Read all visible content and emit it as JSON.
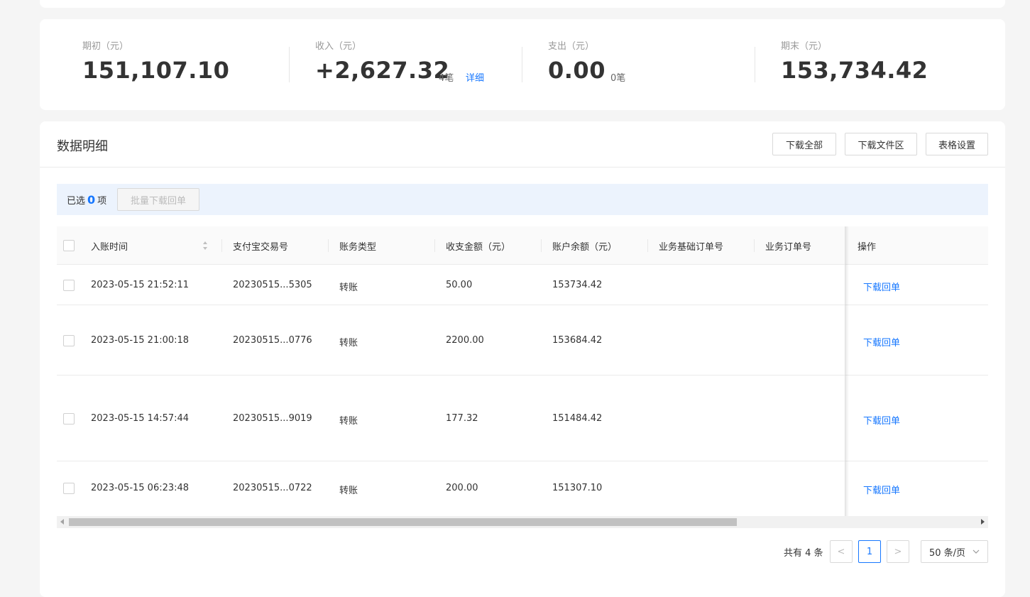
{
  "summary": {
    "opening": {
      "label": "期初（元）",
      "value": "151,107.10"
    },
    "income": {
      "label": "收入（元）",
      "value": "+2,627.32",
      "count": "4笔",
      "detail": "详细"
    },
    "expense": {
      "label": "支出（元）",
      "value": "0.00",
      "count": "0笔"
    },
    "closing": {
      "label": "期末（元）",
      "value": "153,734.42"
    }
  },
  "details": {
    "title": "数据明细",
    "buttons": {
      "download_all": "下载全部",
      "download_area": "下载文件区",
      "table_settings": "表格设置"
    },
    "selection": {
      "prefix": "已选",
      "count": "0",
      "suffix": "项",
      "batch_download": "批量下载回单"
    },
    "columns": [
      "入账时间",
      "支付宝交易号",
      "账务类型",
      "收支金额（元）",
      "账户余额（元）",
      "业务基础订单号",
      "业务订单号",
      "操作"
    ],
    "rows": [
      {
        "time": "2023-05-15 21:52:11",
        "trade_no": "20230515...5305",
        "type": "转账",
        "amount": "50.00",
        "balance": "153734.42",
        "action": "下载回单"
      },
      {
        "time": "2023-05-15 21:00:18",
        "trade_no": "20230515...0776",
        "type": "转账",
        "amount": "2200.00",
        "balance": "153684.42",
        "action": "下载回单"
      },
      {
        "time": "2023-05-15 14:57:44",
        "trade_no": "20230515...9019",
        "type": "转账",
        "amount": "177.32",
        "balance": "151484.42",
        "action": "下载回单"
      },
      {
        "time": "2023-05-15 06:23:48",
        "trade_no": "20230515...0722",
        "type": "转账",
        "amount": "200.00",
        "balance": "151307.10",
        "action": "下载回单"
      }
    ]
  },
  "pagination": {
    "total": "共有 4 条",
    "prev": "<",
    "current": "1",
    "next": ">",
    "page_size": "50 条/页"
  },
  "colors": {
    "accent": "#1677ff",
    "selection_bg": "#ecf3fd"
  }
}
